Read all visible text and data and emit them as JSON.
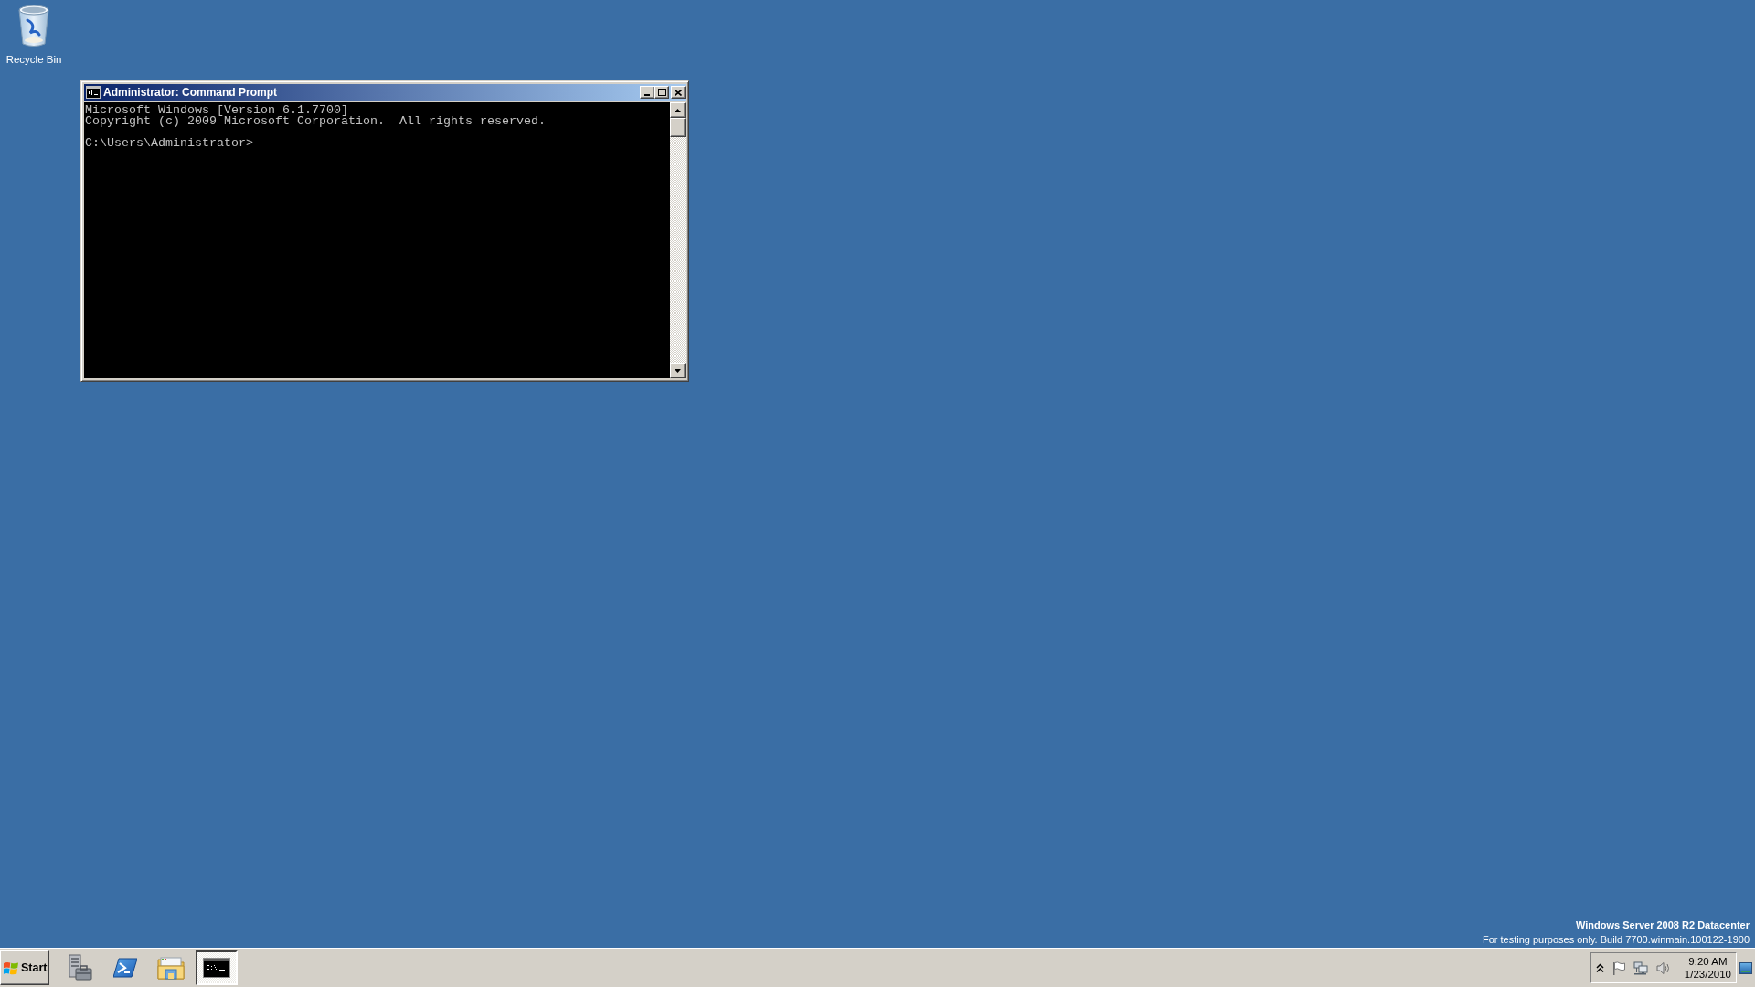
{
  "desktop": {
    "icons": [
      {
        "kind": "recycle-bin",
        "label": "Recycle Bin"
      }
    ],
    "notice": {
      "edition": "Windows Server 2008 R2 Datacenter",
      "build": "For testing purposes only. Build 7700.winmain.100122-1900"
    }
  },
  "window": {
    "title": "Administrator: Command Prompt",
    "console": {
      "banner": [
        "Microsoft Windows [Version 6.1.7700]",
        "Copyright (c) 2009 Microsoft Corporation.  All rights reserved."
      ],
      "prompt": "C:\\Users\\Administrator>"
    }
  },
  "taskbar": {
    "start_button": {
      "label": "Start"
    },
    "buttons": [
      {
        "kind": "server-manager",
        "selected": false
      },
      {
        "kind": "powershell",
        "selected": false
      },
      {
        "kind": "explorer",
        "selected": false
      },
      {
        "kind": "console",
        "selected": true
      }
    ],
    "clock": {
      "time": "9:20 AM",
      "date": "1/23/2010"
    }
  }
}
